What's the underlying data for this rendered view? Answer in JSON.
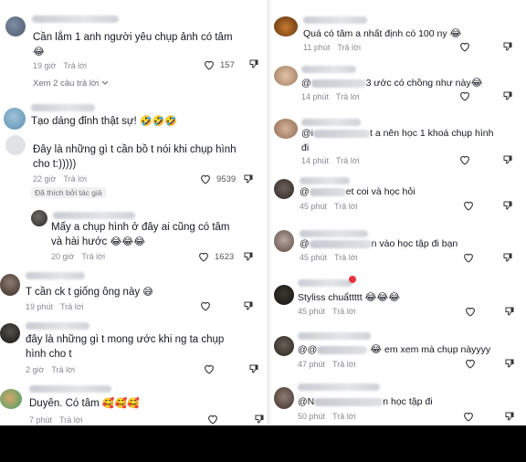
{
  "left": {
    "c1": {
      "text": "Cần lắm 1 anh người yêu chụp ảnh có tâm",
      "emoji": "😂",
      "time": "19 giờ",
      "reply": "Trả lời",
      "likes": "157"
    },
    "view_more": "Xem 2 câu trả lời",
    "c2": {
      "text": "Tạo dáng đỉnh thật sự!",
      "emoji": "🤣🤣🤣"
    },
    "c3": {
      "text": "Đây là những gì t cần bồ t nói khi chụp hình\ncho t:)))))",
      "time": "22 giờ",
      "reply": "Trả lời",
      "likes": "9539",
      "liked_by": "Đã thích bởi tác giả"
    },
    "c4": {
      "text": "Mấy a chụp hình ở đây ai cũng có tâm\nvà hài hước",
      "emoji": "😂😂😂",
      "time": "20 giờ",
      "reply": "Trả lời",
      "likes": "1623"
    },
    "c5": {
      "text": "T cần ck t giống ông này",
      "emoji": "😅",
      "time": "19 phút",
      "reply": "Trả lời"
    },
    "c6": {
      "text": "đây là những gì t mong ước khi ng ta chụp\nhình cho t",
      "time": "2 giờ",
      "reply": "Trả lời"
    },
    "c7": {
      "text": "Duyên. Có tâm",
      "emoji": "🥰🥰🥰",
      "time": "7 phút",
      "reply": "Trả lời"
    }
  },
  "right": {
    "r1": {
      "text": "Quá có tâm a nhất định có 100 ny",
      "emoji": "😂",
      "time": "11 phút",
      "reply": "Trả lời"
    },
    "r2": {
      "prefix": "@",
      "text": "3 ước có chồng như này",
      "emoji": "😂",
      "time": "14 phút",
      "reply": "Trả lời"
    },
    "r3": {
      "prefix": "@i",
      "text": "t a nên học 1 khoá chụp hình\nđi",
      "time": "14 phút",
      "reply": "Trả lời"
    },
    "r4": {
      "prefix": "@",
      "text": "et coi và học hỏi",
      "time": "45 phút",
      "reply": "Trả lời"
    },
    "r5": {
      "prefix": "@",
      "text": "n vào học tập đi bạn",
      "time": "45 phút",
      "reply": "Trả lời"
    },
    "r6": {
      "text": "Styliss chuẩttttt",
      "emoji": "😂😂😂",
      "time": "45 phút",
      "reply": "Trả lời"
    },
    "r7": {
      "prefix": "@@",
      "emoji": "😂",
      "text": "em xem mà chụp nàyyyy",
      "time": "47 phút",
      "reply": "Trả lời"
    },
    "r8": {
      "prefix": "@N",
      "text": "n học tập đi",
      "time": "50 phút",
      "reply": "Trả lời"
    }
  },
  "colors": {
    "text": "#161823",
    "meta": "#8a8b91",
    "bottom_bar": "#000000"
  },
  "icons": [
    "heart-outline-icon",
    "dislike-icon",
    "chevron-down-icon"
  ]
}
